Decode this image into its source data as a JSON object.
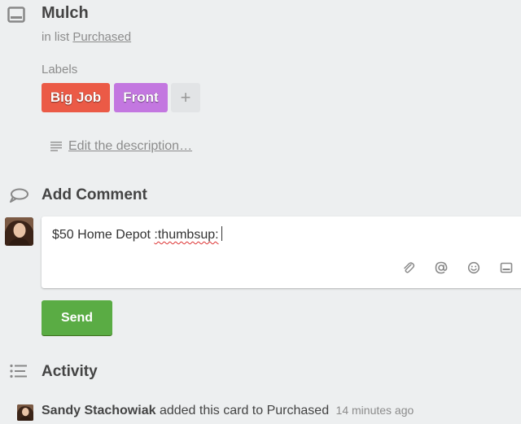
{
  "card": {
    "title": "Mulch",
    "in_list_prefix": "in list",
    "list_name": "Purchased"
  },
  "labels": {
    "heading": "Labels",
    "items": [
      {
        "text": "Big Job",
        "color": "#eb5a46"
      },
      {
        "text": "Front",
        "color": "#c377e0"
      }
    ],
    "add_symbol": "+"
  },
  "description": {
    "link_text": "Edit the description…"
  },
  "add_comment": {
    "heading": "Add Comment",
    "text_plain": "$50 Home Depot ",
    "text_flagged": ":thumbsup:",
    "icons": [
      "paperclip-icon",
      "mention-icon",
      "emoji-icon",
      "card-icon"
    ],
    "send_label": "Send"
  },
  "activity": {
    "heading": "Activity",
    "entries": [
      {
        "user": "Sandy Stachowiak",
        "action": "added this card to Purchased",
        "time": "14 minutes ago"
      }
    ]
  },
  "colors": {
    "send": "#5aac44",
    "background": "#edeff0"
  }
}
